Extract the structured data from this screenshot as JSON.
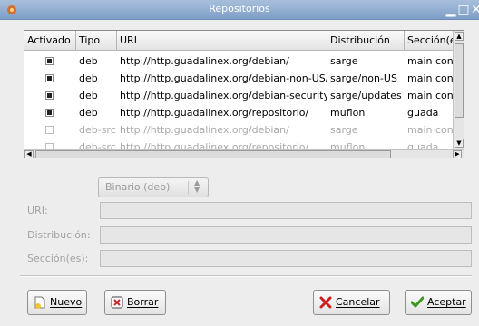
{
  "window": {
    "title": "Repositorios",
    "controls": [
      "minimize",
      "maximize",
      "close"
    ]
  },
  "table": {
    "headers": [
      "Activado",
      "Tipo",
      "URI",
      "Distribución",
      "Sección(es"
    ],
    "rows": [
      {
        "active": true,
        "type": "deb",
        "uri": "http://http.guadalinex.org/debian/",
        "distribution": "sarge",
        "sections": "main contr",
        "enabled": true
      },
      {
        "active": true,
        "type": "deb",
        "uri": "http://http.guadalinex.org/debian-non-US/",
        "distribution": "sarge/non-US",
        "sections": "main contr",
        "enabled": true
      },
      {
        "active": true,
        "type": "deb",
        "uri": "http://http.guadalinex.org/debian-security/",
        "distribution": "sarge/updates",
        "sections": "main contr",
        "enabled": true
      },
      {
        "active": true,
        "type": "deb",
        "uri": "http://http.guadalinex.org/repositorio/",
        "distribution": "muflon",
        "sections": "guada",
        "enabled": true
      },
      {
        "active": false,
        "type": "deb-src",
        "uri": "http://http.guadalinex.org/debian/",
        "distribution": "sarge",
        "sections": "main contr",
        "enabled": false
      },
      {
        "active": false,
        "type": "deb-src",
        "uri": "http://http.guadalinex.org/repositorio/",
        "distribution": "muflon",
        "sections": "guada",
        "enabled": false
      }
    ]
  },
  "form": {
    "type_combo": {
      "value": "Binario (deb)"
    },
    "uri_label": "URI:",
    "uri_value": "",
    "distribution_label": "Distribución:",
    "distribution_value": "",
    "sections_label": "Sección(es):",
    "sections_value": ""
  },
  "buttons": {
    "new": "Nuevo",
    "delete": "Borrar",
    "cancel": "Cancelar",
    "accept": "Aceptar"
  },
  "colors": {
    "titlebar": "#8eaad0",
    "disabled_text": "#a9a9a9",
    "accept_check": "#3c9a22",
    "cancel_x": "#cc1f1f"
  }
}
